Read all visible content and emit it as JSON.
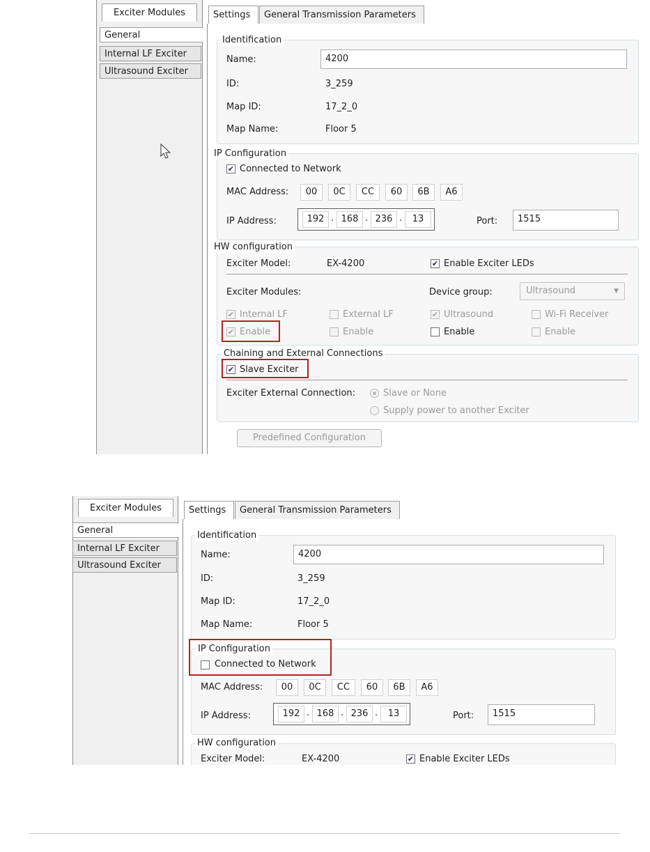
{
  "top": {
    "sidebar": {
      "tab_label": "Exciter Modules",
      "items": [
        {
          "label": "General"
        },
        {
          "label": "Internal LF Exciter"
        },
        {
          "label": "Ultrasound Exciter"
        }
      ]
    },
    "tabs": [
      "Settings",
      "General Transmission Parameters"
    ],
    "identification": {
      "title": "Identification",
      "name_label": "Name:",
      "name_value": "4200",
      "id_label": "ID:",
      "id_value": "3_259",
      "mapid_label": "Map ID:",
      "mapid_value": "17_2_0",
      "mapname_label": "Map Name:",
      "mapname_value": "Floor 5"
    },
    "ip_config": {
      "title": "IP Configuration",
      "connected_label": "Connected to Network",
      "connected_checked": true,
      "mac_label": "MAC Address:",
      "mac": [
        "00",
        "0C",
        "CC",
        "60",
        "6B",
        "A6"
      ],
      "ip_label": "IP Address:",
      "ip": [
        "192",
        "168",
        "236",
        "13"
      ],
      "ip_dots": ".",
      "port_label": "Port:",
      "port_value": "1515"
    },
    "hw_config": {
      "title": "HW configuration",
      "model_label": "Exciter Model:",
      "model_value": "EX-4200",
      "leds_label": "Enable Exciter LEDs",
      "leds_checked": true,
      "modules_label": "Exciter Modules:",
      "device_group_label": "Device group:",
      "device_group_value": "Ultrasound",
      "modules": [
        {
          "label": "Internal LF",
          "checked": true,
          "enable_label": "Enable",
          "enable_checked": true
        },
        {
          "label": "External LF",
          "checked": false,
          "enable_label": "Enable",
          "enable_checked": false
        },
        {
          "label": "Ultrasound",
          "checked": true,
          "enable_label": "Enable",
          "enable_checked": false
        },
        {
          "label": "Wi-Fi Receiver",
          "checked": false,
          "enable_label": "Enable",
          "enable_checked": false
        }
      ]
    },
    "chaining": {
      "title": "Chaining and External Connections",
      "slave_label": "Slave Exciter",
      "slave_checked": true,
      "ext_conn_label": "Exciter External Connection:",
      "options": [
        "Slave or None",
        "Supply power to another Exciter"
      ],
      "selected_option": "Slave or None"
    },
    "predefined_button": "Predefined Configuration"
  },
  "bottom": {
    "sidebar": {
      "tab_label": "Exciter Modules",
      "items": [
        {
          "label": "General"
        },
        {
          "label": "Internal LF Exciter"
        },
        {
          "label": "Ultrasound Exciter"
        }
      ]
    },
    "tabs": [
      "Settings",
      "General Transmission Parameters"
    ],
    "identification": {
      "title": "Identification",
      "name_label": "Name:",
      "name_value": "4200",
      "id_label": "ID:",
      "id_value": "3_259",
      "mapid_label": "Map ID:",
      "mapid_value": "17_2_0",
      "mapname_label": "Map Name:",
      "mapname_value": "Floor 5"
    },
    "ip_config": {
      "title": "IP Configuration",
      "connected_label": "Connected to Network",
      "connected_checked": false,
      "mac_label": "MAC Address:",
      "mac": [
        "00",
        "0C",
        "CC",
        "60",
        "6B",
        "A6"
      ],
      "ip_label": "IP Address:",
      "ip": [
        "192",
        "168",
        "236",
        "13"
      ],
      "ip_dots": ".",
      "port_label": "Port:",
      "port_value": "1515"
    },
    "hw_config": {
      "title": "HW configuration",
      "model_label": "Exciter Model:",
      "model_value": "EX-4200",
      "leds_label": "Enable Exciter LEDs",
      "leds_checked": true
    }
  },
  "colors": {
    "highlight": "#b22222",
    "group_border": "#d5dfe5",
    "check": "#203050"
  },
  "icons": {
    "check": "✔",
    "dropdown": "▼",
    "cursor": "arrow-cursor-icon"
  }
}
